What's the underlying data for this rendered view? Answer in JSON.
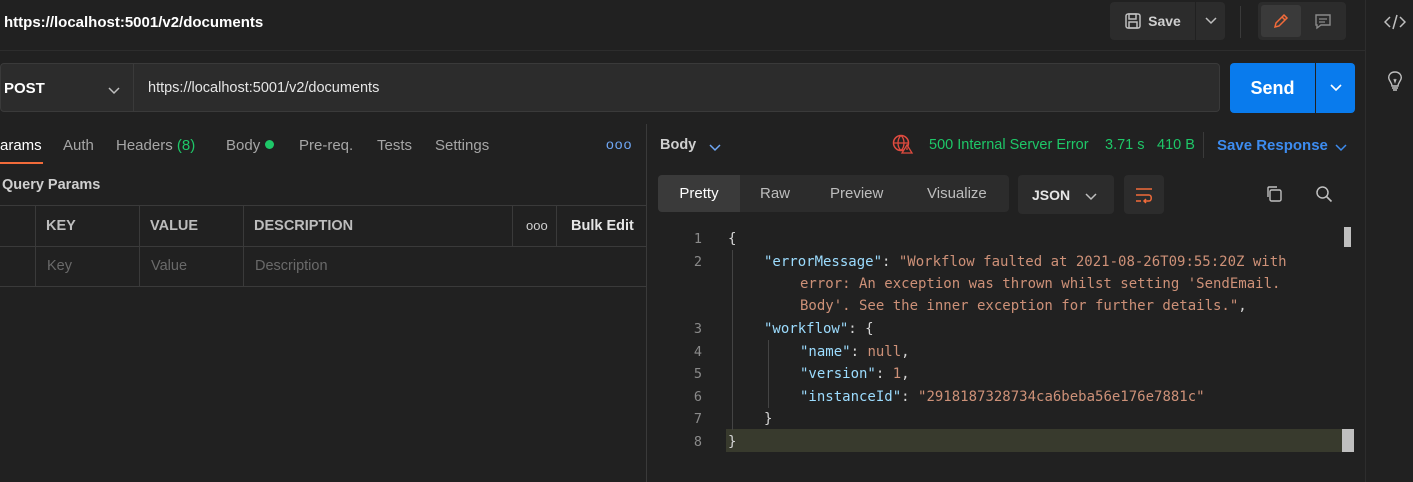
{
  "header": {
    "title": "https://localhost:5001/v2/documents",
    "save_label": "Save"
  },
  "request": {
    "method": "POST",
    "url": "https://localhost:5001/v2/documents",
    "send_label": "Send",
    "tabs": [
      {
        "label": "arams"
      },
      {
        "label": "Auth"
      },
      {
        "label": "Headers",
        "count": "(8)"
      },
      {
        "label": "Body"
      },
      {
        "label": "Pre-req."
      },
      {
        "label": "Tests"
      },
      {
        "label": "Settings"
      }
    ],
    "more": "ooo",
    "query_params": {
      "title": "Query Params",
      "columns": [
        "KEY",
        "VALUE",
        "DESCRIPTION"
      ],
      "bulk_edit": "Bulk Edit",
      "col_more": "ooo",
      "placeholders": [
        "Key",
        "Value",
        "Description"
      ]
    }
  },
  "response": {
    "body_label": "Body",
    "status": "500 Internal Server Error",
    "time": "3.71 s",
    "size": "410 B",
    "save_response": "Save Response",
    "views": [
      "Pretty",
      "Raw",
      "Preview",
      "Visualize"
    ],
    "format": "JSON",
    "line_numbers": [
      "1",
      "2",
      "3",
      "4",
      "5",
      "6",
      "7",
      "8"
    ],
    "code": {
      "open_brace": "{",
      "error_key": "\"errorMessage\"",
      "error_colon": ": ",
      "error_val_1": "\"Workflow faulted at 2021-08-26T09:55:20Z with",
      "error_val_2": "error: An exception was thrown whilst setting 'SendEmail.",
      "error_val_3": "Body'. See the inner exception for further details.\"",
      "error_comma": ",",
      "workflow_key": "\"workflow\"",
      "workflow_open": ": {",
      "name_key": "\"name\"",
      "name_val": "null",
      "version_key": "\"version\"",
      "version_val": "1",
      "instance_key": "\"instanceId\"",
      "instance_val": "\"2918187328734ca6beba56e176e7881c\"",
      "inner_close": "}",
      "close_brace": "}"
    }
  },
  "colors": {
    "accent_orange": "#f26b3a",
    "send_blue": "#097bed",
    "status_green": "#1ec768",
    "link_blue": "#3d8cf0"
  },
  "icons": [
    "save-icon",
    "chevron-down-icon",
    "pencil-icon",
    "comment-icon",
    "code-icon",
    "lightbulb-icon",
    "globe-error-icon",
    "wrap-icon",
    "copy-icon",
    "search-icon"
  ]
}
